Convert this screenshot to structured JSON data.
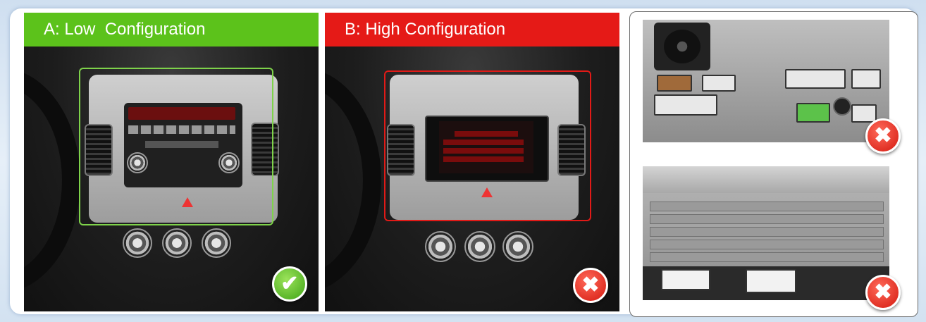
{
  "panels": [
    {
      "label": "A: Low  Configuration",
      "color": "#5cc21b",
      "status": "check"
    },
    {
      "label": "B: High Configuration",
      "color": "#e51a17",
      "status": "cross"
    }
  ],
  "photos": [
    {
      "status": "cross"
    },
    {
      "status": "cross"
    }
  ],
  "colors": {
    "ok": "#5cc21b",
    "no": "#e51a17"
  },
  "icons": {
    "check": "✔",
    "cross": "✖"
  }
}
